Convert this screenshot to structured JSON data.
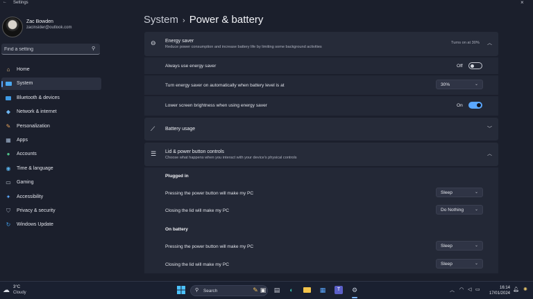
{
  "window": {
    "title": "Settings"
  },
  "profile": {
    "name": "Zac Bowden",
    "email": "zacinsider@outlook.com"
  },
  "search": {
    "placeholder": "Find a setting"
  },
  "sidebar": {
    "items": [
      {
        "label": "Home",
        "icon": "home-icon",
        "active": false
      },
      {
        "label": "System",
        "icon": "system-icon",
        "active": true
      },
      {
        "label": "Bluetooth & devices",
        "icon": "bluetooth-icon",
        "active": false
      },
      {
        "label": "Network & internet",
        "icon": "wifi-icon",
        "active": false
      },
      {
        "label": "Personalization",
        "icon": "brush-icon",
        "active": false
      },
      {
        "label": "Apps",
        "icon": "apps-icon",
        "active": false
      },
      {
        "label": "Accounts",
        "icon": "accounts-icon",
        "active": false
      },
      {
        "label": "Time & language",
        "icon": "globe-icon",
        "active": false
      },
      {
        "label": "Gaming",
        "icon": "gamepad-icon",
        "active": false
      },
      {
        "label": "Accessibility",
        "icon": "accessibility-icon",
        "active": false
      },
      {
        "label": "Privacy & security",
        "icon": "shield-icon",
        "active": false
      },
      {
        "label": "Windows Update",
        "icon": "update-icon",
        "active": false
      }
    ]
  },
  "header": {
    "crumb": "System",
    "title": "Power & battery"
  },
  "energy_saver": {
    "title": "Energy saver",
    "subtitle": "Reduce power consumption and increase battery life by limiting some background activities",
    "status": "Turns on at 30%",
    "always_label": "Always use energy saver",
    "always_state": "Off",
    "auto_label": "Turn energy saver on automatically when battery level is at",
    "auto_value": "30%",
    "brightness_label": "Lower screen brightness when using energy saver",
    "brightness_state": "On"
  },
  "battery_usage": {
    "title": "Battery usage"
  },
  "lid": {
    "title": "Lid & power button controls",
    "subtitle": "Choose what happens when you interact with your device's physical controls",
    "plugged_in": {
      "heading": "Plugged in",
      "power_label": "Pressing the power button will make my PC",
      "power_value": "Sleep",
      "lid_label": "Closing the lid will make my PC",
      "lid_value": "Do Nothing"
    },
    "on_battery": {
      "heading": "On battery",
      "power_label": "Pressing the power button will make my PC",
      "power_value": "Sleep",
      "lid_label": "Closing the lid will make my PC",
      "lid_value": "Sleep"
    }
  },
  "taskbar": {
    "weather_temp": "3°C",
    "weather_cond": "Cloudy",
    "search_label": "Search",
    "time": "16:14",
    "date": "17/01/2024"
  },
  "colors": {
    "accent": "#5aa7ff",
    "background": "#1b1f2c",
    "card": "#262b39"
  }
}
